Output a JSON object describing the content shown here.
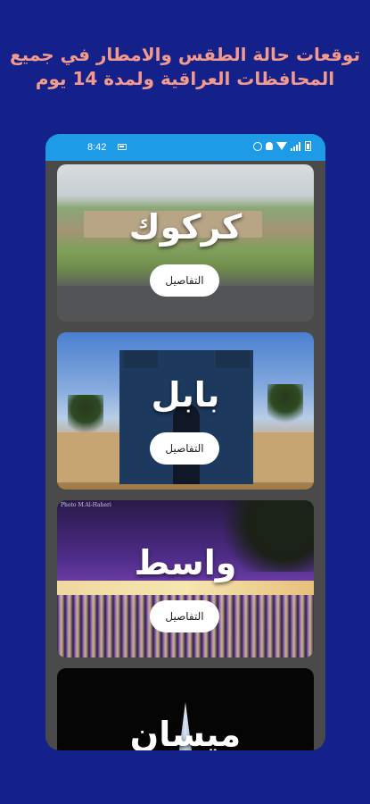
{
  "promo": {
    "line1": "توقعات حالة الطقس والامطار في جميع",
    "line2": "المحافظات العراقية ولمدة 14 يوم"
  },
  "status_bar": {
    "time": "8:42",
    "icons": [
      "message-icon",
      "alarm-icon",
      "person-icon",
      "wifi-icon",
      "signal-icon",
      "battery-icon"
    ],
    "color": "#1e9be6"
  },
  "cities": [
    {
      "name": "كركوك",
      "button": "التفاصيل",
      "image": "kirkuk-citadel-photo"
    },
    {
      "name": "بابل",
      "button": "التفاصيل",
      "image": "babylon-ishtar-gate-photo"
    },
    {
      "name": "واسط",
      "button": "التفاصيل",
      "image": "wasit-night-bridge-photo",
      "credit": "Photo M.Al-Haheri"
    },
    {
      "name": "ميسان",
      "button": "",
      "image": "maysan-night-tower-photo"
    }
  ],
  "colors": {
    "background": "#14218a",
    "promo_text": "#f39a8c",
    "phone_body": "#4a4a4a",
    "button_bg": "#ffffff"
  }
}
